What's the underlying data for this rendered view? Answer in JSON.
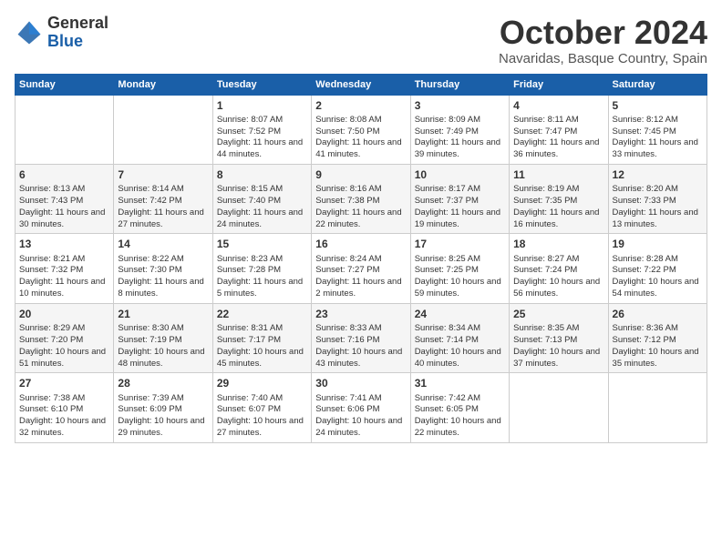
{
  "header": {
    "logo_general": "General",
    "logo_blue": "Blue",
    "month_title": "October 2024",
    "subtitle": "Navaridas, Basque Country, Spain"
  },
  "days_of_week": [
    "Sunday",
    "Monday",
    "Tuesday",
    "Wednesday",
    "Thursday",
    "Friday",
    "Saturday"
  ],
  "weeks": [
    [
      {
        "day": "",
        "info": ""
      },
      {
        "day": "",
        "info": ""
      },
      {
        "day": "1",
        "info": "Sunrise: 8:07 AM\nSunset: 7:52 PM\nDaylight: 11 hours and 44 minutes."
      },
      {
        "day": "2",
        "info": "Sunrise: 8:08 AM\nSunset: 7:50 PM\nDaylight: 11 hours and 41 minutes."
      },
      {
        "day": "3",
        "info": "Sunrise: 8:09 AM\nSunset: 7:49 PM\nDaylight: 11 hours and 39 minutes."
      },
      {
        "day": "4",
        "info": "Sunrise: 8:11 AM\nSunset: 7:47 PM\nDaylight: 11 hours and 36 minutes."
      },
      {
        "day": "5",
        "info": "Sunrise: 8:12 AM\nSunset: 7:45 PM\nDaylight: 11 hours and 33 minutes."
      }
    ],
    [
      {
        "day": "6",
        "info": "Sunrise: 8:13 AM\nSunset: 7:43 PM\nDaylight: 11 hours and 30 minutes."
      },
      {
        "day": "7",
        "info": "Sunrise: 8:14 AM\nSunset: 7:42 PM\nDaylight: 11 hours and 27 minutes."
      },
      {
        "day": "8",
        "info": "Sunrise: 8:15 AM\nSunset: 7:40 PM\nDaylight: 11 hours and 24 minutes."
      },
      {
        "day": "9",
        "info": "Sunrise: 8:16 AM\nSunset: 7:38 PM\nDaylight: 11 hours and 22 minutes."
      },
      {
        "day": "10",
        "info": "Sunrise: 8:17 AM\nSunset: 7:37 PM\nDaylight: 11 hours and 19 minutes."
      },
      {
        "day": "11",
        "info": "Sunrise: 8:19 AM\nSunset: 7:35 PM\nDaylight: 11 hours and 16 minutes."
      },
      {
        "day": "12",
        "info": "Sunrise: 8:20 AM\nSunset: 7:33 PM\nDaylight: 11 hours and 13 minutes."
      }
    ],
    [
      {
        "day": "13",
        "info": "Sunrise: 8:21 AM\nSunset: 7:32 PM\nDaylight: 11 hours and 10 minutes."
      },
      {
        "day": "14",
        "info": "Sunrise: 8:22 AM\nSunset: 7:30 PM\nDaylight: 11 hours and 8 minutes."
      },
      {
        "day": "15",
        "info": "Sunrise: 8:23 AM\nSunset: 7:28 PM\nDaylight: 11 hours and 5 minutes."
      },
      {
        "day": "16",
        "info": "Sunrise: 8:24 AM\nSunset: 7:27 PM\nDaylight: 11 hours and 2 minutes."
      },
      {
        "day": "17",
        "info": "Sunrise: 8:25 AM\nSunset: 7:25 PM\nDaylight: 10 hours and 59 minutes."
      },
      {
        "day": "18",
        "info": "Sunrise: 8:27 AM\nSunset: 7:24 PM\nDaylight: 10 hours and 56 minutes."
      },
      {
        "day": "19",
        "info": "Sunrise: 8:28 AM\nSunset: 7:22 PM\nDaylight: 10 hours and 54 minutes."
      }
    ],
    [
      {
        "day": "20",
        "info": "Sunrise: 8:29 AM\nSunset: 7:20 PM\nDaylight: 10 hours and 51 minutes."
      },
      {
        "day": "21",
        "info": "Sunrise: 8:30 AM\nSunset: 7:19 PM\nDaylight: 10 hours and 48 minutes."
      },
      {
        "day": "22",
        "info": "Sunrise: 8:31 AM\nSunset: 7:17 PM\nDaylight: 10 hours and 45 minutes."
      },
      {
        "day": "23",
        "info": "Sunrise: 8:33 AM\nSunset: 7:16 PM\nDaylight: 10 hours and 43 minutes."
      },
      {
        "day": "24",
        "info": "Sunrise: 8:34 AM\nSunset: 7:14 PM\nDaylight: 10 hours and 40 minutes."
      },
      {
        "day": "25",
        "info": "Sunrise: 8:35 AM\nSunset: 7:13 PM\nDaylight: 10 hours and 37 minutes."
      },
      {
        "day": "26",
        "info": "Sunrise: 8:36 AM\nSunset: 7:12 PM\nDaylight: 10 hours and 35 minutes."
      }
    ],
    [
      {
        "day": "27",
        "info": "Sunrise: 7:38 AM\nSunset: 6:10 PM\nDaylight: 10 hours and 32 minutes."
      },
      {
        "day": "28",
        "info": "Sunrise: 7:39 AM\nSunset: 6:09 PM\nDaylight: 10 hours and 29 minutes."
      },
      {
        "day": "29",
        "info": "Sunrise: 7:40 AM\nSunset: 6:07 PM\nDaylight: 10 hours and 27 minutes."
      },
      {
        "day": "30",
        "info": "Sunrise: 7:41 AM\nSunset: 6:06 PM\nDaylight: 10 hours and 24 minutes."
      },
      {
        "day": "31",
        "info": "Sunrise: 7:42 AM\nSunset: 6:05 PM\nDaylight: 10 hours and 22 minutes."
      },
      {
        "day": "",
        "info": ""
      },
      {
        "day": "",
        "info": ""
      }
    ]
  ]
}
